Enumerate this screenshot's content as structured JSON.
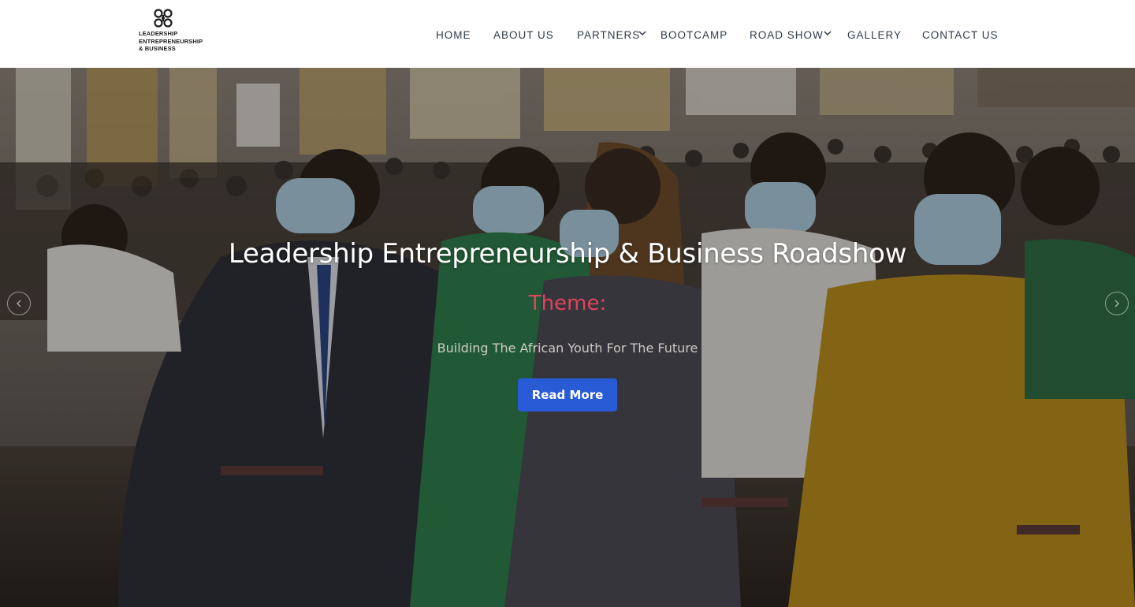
{
  "brand": {
    "logo_lines": [
      "LEADERSHIP",
      "ENTREPRENEURSHIP",
      "& BUSINESS"
    ]
  },
  "nav": {
    "items": [
      {
        "label": "HOME",
        "has_dropdown": false
      },
      {
        "label": "ABOUT US",
        "has_dropdown": false
      },
      {
        "label": "PARTNERS",
        "has_dropdown": true
      },
      {
        "label": "BOOTCAMP",
        "has_dropdown": false
      },
      {
        "label": "ROAD SHOW",
        "has_dropdown": true
      },
      {
        "label": "GALLERY",
        "has_dropdown": false
      },
      {
        "label": "CONTACT US",
        "has_dropdown": false
      }
    ]
  },
  "hero": {
    "title": "Leadership Entrepreneurship & Business Roadshow",
    "theme_label": "Theme:",
    "subtitle": "Building The African Youth For The Future",
    "cta_label": "Read More"
  },
  "colors": {
    "accent": "#2a5bd7",
    "theme_text": "#e0445c",
    "nav_text": "#2f3a4a"
  },
  "icons": {
    "logo": "knot-symbol-icon",
    "dropdown": "chevron-down-icon",
    "prev": "chevron-left-icon",
    "next": "chevron-right-icon"
  }
}
